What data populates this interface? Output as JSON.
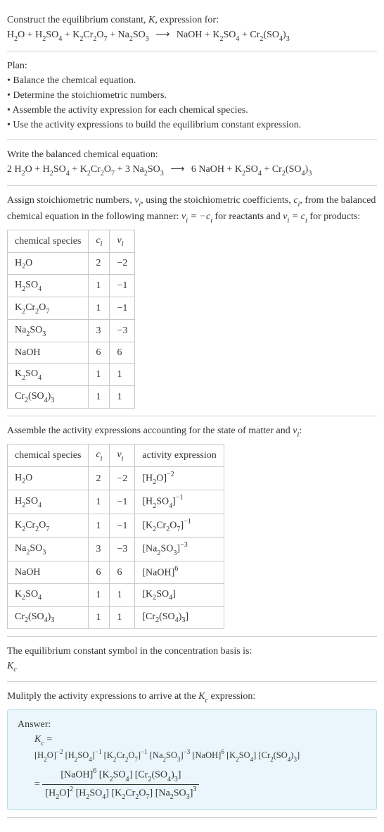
{
  "intro": {
    "line1": "Construct the equilibrium constant, ",
    "K": "K",
    "line1b": ", expression for:",
    "eq_left": "H₂O + H₂SO₄ + K₂Cr₂O₇ + Na₂SO₃",
    "eq_right": "NaOH + K₂SO₄ + Cr₂(SO₄)₃"
  },
  "plan": {
    "heading": "Plan:",
    "items": [
      "Balance the chemical equation.",
      "Determine the stoichiometric numbers.",
      "Assemble the activity expression for each chemical species.",
      "Use the activity expressions to build the equilibrium constant expression."
    ]
  },
  "balanced": {
    "heading": "Write the balanced chemical equation:",
    "eq_left": "2 H₂O + H₂SO₄ + K₂Cr₂O₇ + 3 Na₂SO₃",
    "eq_right": "6 NaOH + K₂SO₄ + Cr₂(SO₄)₃"
  },
  "stoich": {
    "text_a": "Assign stoichiometric numbers, ",
    "nu": "ν",
    "sub_i": "i",
    "text_b": ", using the stoichiometric coefficients, ",
    "c": "c",
    "text_c": ", from the balanced chemical equation in the following manner: ",
    "rel1": "νᵢ = −cᵢ",
    "text_d": " for reactants and ",
    "rel2": "νᵢ = cᵢ",
    "text_e": " for products:",
    "headers": [
      "chemical species",
      "cᵢ",
      "νᵢ"
    ],
    "rows": [
      {
        "species": "H₂O",
        "c": "2",
        "nu": "−2"
      },
      {
        "species": "H₂SO₄",
        "c": "1",
        "nu": "−1"
      },
      {
        "species": "K₂Cr₂O₇",
        "c": "1",
        "nu": "−1"
      },
      {
        "species": "Na₂SO₃",
        "c": "3",
        "nu": "−3"
      },
      {
        "species": "NaOH",
        "c": "6",
        "nu": "6"
      },
      {
        "species": "K₂SO₄",
        "c": "1",
        "nu": "1"
      },
      {
        "species": "Cr₂(SO₄)₃",
        "c": "1",
        "nu": "1"
      }
    ]
  },
  "activity": {
    "heading_a": "Assemble the activity expressions accounting for the state of matter and ",
    "heading_b": ":",
    "headers": [
      "chemical species",
      "cᵢ",
      "νᵢ",
      "activity expression"
    ],
    "rows": [
      {
        "species": "H₂O",
        "c": "2",
        "nu": "−2",
        "expr_base": "[H₂O]",
        "expr_pow": "−2"
      },
      {
        "species": "H₂SO₄",
        "c": "1",
        "nu": "−1",
        "expr_base": "[H₂SO₄]",
        "expr_pow": "−1"
      },
      {
        "species": "K₂Cr₂O₇",
        "c": "1",
        "nu": "−1",
        "expr_base": "[K₂Cr₂O₇]",
        "expr_pow": "−1"
      },
      {
        "species": "Na₂SO₃",
        "c": "3",
        "nu": "−3",
        "expr_base": "[Na₂SO₃]",
        "expr_pow": "−3"
      },
      {
        "species": "NaOH",
        "c": "6",
        "nu": "6",
        "expr_base": "[NaOH]",
        "expr_pow": "6"
      },
      {
        "species": "K₂SO₄",
        "c": "1",
        "nu": "1",
        "expr_base": "[K₂SO₄]",
        "expr_pow": ""
      },
      {
        "species": "Cr₂(SO₄)₃",
        "c": "1",
        "nu": "1",
        "expr_base": "[Cr₂(SO₄)₃]",
        "expr_pow": ""
      }
    ]
  },
  "kc_symbol": {
    "line1": "The equilibrium constant symbol in the concentration basis is:",
    "kc": "K",
    "kc_sub": "c"
  },
  "multiply": {
    "heading": "Mulitply the activity expressions to arrive at the ",
    "kc": "K",
    "kc_sub": "c",
    "heading_b": " expression:"
  },
  "answer": {
    "label": "Answer:",
    "kc": "K",
    "kc_sub": "c",
    "eq": " = ",
    "line1_terms": [
      {
        "base": "[H₂O]",
        "pow": "−2"
      },
      {
        "base": "[H₂SO₄]",
        "pow": "−1"
      },
      {
        "base": "[K₂Cr₂O₇]",
        "pow": "−1"
      },
      {
        "base": "[Na₂SO₃]",
        "pow": "−3"
      },
      {
        "base": "[NaOH]",
        "pow": "6"
      },
      {
        "base": "[K₂SO₄]",
        "pow": ""
      },
      {
        "base": "[Cr₂(SO₄)₃]",
        "pow": ""
      }
    ],
    "frac_num": [
      {
        "base": "[NaOH]",
        "pow": "6"
      },
      {
        "base": "[K₂SO₄]",
        "pow": ""
      },
      {
        "base": "[Cr₂(SO₄)₃]",
        "pow": ""
      }
    ],
    "frac_den": [
      {
        "base": "[H₂O]",
        "pow": "2"
      },
      {
        "base": "[H₂SO₄]",
        "pow": ""
      },
      {
        "base": "[K₂Cr₂O₇]",
        "pow": ""
      },
      {
        "base": "[Na₂SO₃]",
        "pow": "3"
      }
    ]
  }
}
